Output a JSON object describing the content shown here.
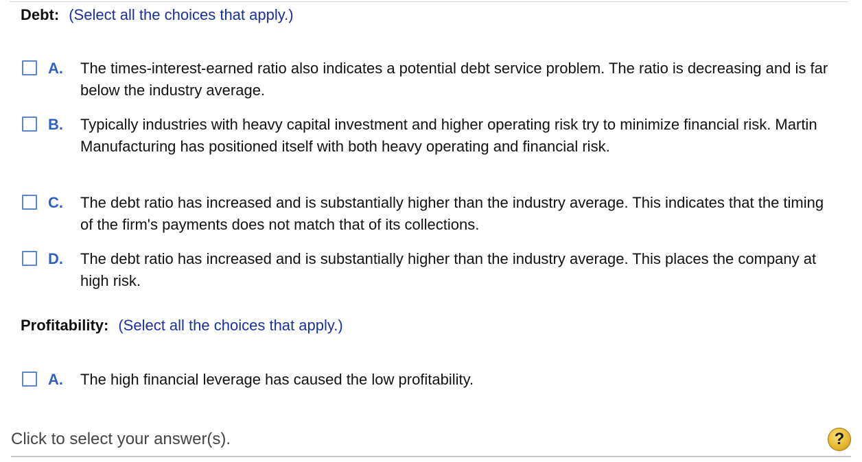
{
  "sections": [
    {
      "label": "Debt:",
      "instruction": "(Select all the choices that apply.)",
      "choices": [
        {
          "letter": "A.",
          "text": "The times-interest-earned ratio also indicates a potential debt service problem. The ratio is decreasing and is far below the industry average.",
          "checked": false
        },
        {
          "letter": "B.",
          "text": "Typically industries with heavy capital investment and higher operating risk try to minimize financial risk. Martin Manufacturing has positioned itself with both heavy operating and financial risk.",
          "checked": false
        },
        {
          "letter": "C.",
          "text": "The debt ratio has increased and is substantially higher than the industry average. This indicates that the timing of the firm's payments does not match that of its collections.",
          "checked": false
        },
        {
          "letter": "D.",
          "text": "The debt ratio has increased and is substantially higher than the industry average. This places the company at high risk.",
          "checked": false
        }
      ]
    },
    {
      "label": "Profitability:",
      "instruction": "(Select all the choices that apply.)",
      "choices": [
        {
          "letter": "A.",
          "text": "The high financial leverage has caused the low profitability.",
          "checked": false
        }
      ]
    }
  ],
  "footer": {
    "prompt": "Click to select your answer(s).",
    "help_label": "?",
    "help_icon": "question-mark-icon"
  },
  "colors": {
    "instruction": "#1a2f9e",
    "choice_letter": "#2f5fc6",
    "checkbox_border": "#5b86c9",
    "help_button": "#e6b52b"
  }
}
